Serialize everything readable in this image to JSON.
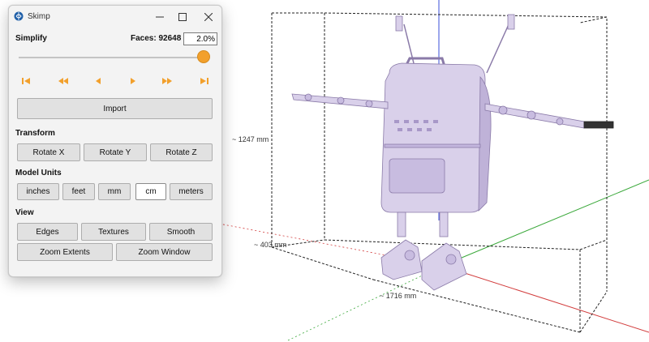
{
  "window": {
    "title": "Skimp"
  },
  "simplify": {
    "label": "Simplify",
    "faces_label": "Faces: 92648",
    "percent_value": "2.0%",
    "slider_fraction": 1.0
  },
  "playback": {
    "icons": [
      "skip-to-start-icon",
      "rewind-icon",
      "step-back-icon",
      "step-forward-icon",
      "fast-forward-icon",
      "skip-to-end-icon"
    ]
  },
  "import_label": "Import",
  "transform": {
    "label": "Transform",
    "buttons": [
      "Rotate X",
      "Rotate Y",
      "Rotate Z"
    ]
  },
  "model_units": {
    "label": "Model Units",
    "buttons": [
      "inches",
      "feet",
      "mm",
      "cm",
      "meters"
    ],
    "selected": "cm"
  },
  "view": {
    "label": "View",
    "buttons": [
      "Edges",
      "Textures",
      "Smooth"
    ],
    "zoom_extents": "Zoom Extents",
    "zoom_window": "Zoom Window"
  },
  "viewport": {
    "dim_height": "~ 1247 mm",
    "dim_depth": "~ 403 mm",
    "dim_width": "~ 1716 mm",
    "axis_colors": {
      "x": "#d23c3c",
      "y": "#3aa83a",
      "z": "#3a4fd8"
    },
    "model_color": "#d9d0ea"
  },
  "colors": {
    "accent": "#f2a02c"
  }
}
